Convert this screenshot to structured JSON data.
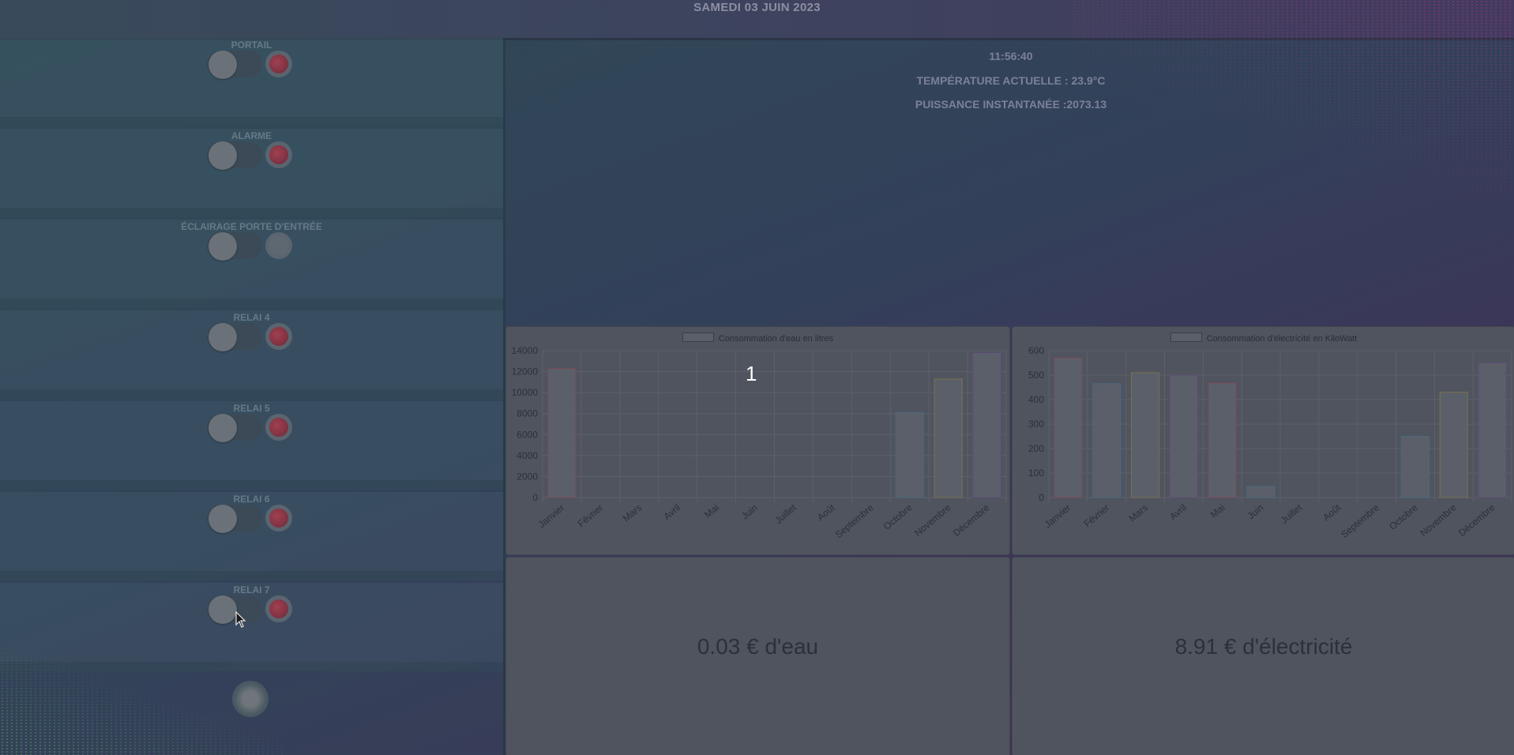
{
  "header": {
    "date": "SAMEDI 03 JUIN 2023"
  },
  "info": {
    "time": "11:56:40",
    "temperature": "TEMPÉRATURE ACTUELLE : 23.9°C",
    "power": "PUISSANCE INSTANTANÉE :2073.13"
  },
  "relays": [
    {
      "label": "PORTAIL",
      "led": "red"
    },
    {
      "label": "ALARME",
      "led": "red"
    },
    {
      "label": "ÉCLAIRAGE PORTE D'ENTRÉE",
      "led": "off"
    },
    {
      "label": "RELAI 4",
      "led": "red"
    },
    {
      "label": "RELAI 5",
      "led": "red"
    },
    {
      "label": "RELAI 6",
      "led": "red"
    },
    {
      "label": "RELAI 7",
      "led": "red"
    }
  ],
  "page_indicator": "1",
  "costs": {
    "water": "0.03 € d'eau",
    "electricity": "8.91 € d'électricité"
  },
  "colors": {
    "bar_fill": "#5b5f6a",
    "bar_stroke_red": "#7a4a55",
    "bar_stroke_blue": "#4a6a7e",
    "bar_stroke_yellow": "#7a7250",
    "bar_stroke_purple": "#5e4e78",
    "grid": "#5c616b",
    "tick_text": "#2c3039"
  },
  "chart_data": [
    {
      "type": "bar",
      "legend": "Consommation d'eau en litres",
      "categories": [
        "Janvier",
        "Février",
        "Mars",
        "Avril",
        "Mai",
        "Juin",
        "Juillet",
        "Août",
        "Septembre",
        "Octobre",
        "Novembre",
        "Décembre"
      ],
      "values": [
        12300,
        0,
        0,
        0,
        0,
        0,
        0,
        0,
        0,
        8100,
        11300,
        13800
      ],
      "yticks": [
        "0",
        "2000",
        "4000",
        "6000",
        "8000",
        "10000",
        "12000",
        "14000"
      ],
      "ylim": [
        0,
        14000
      ],
      "grid": true
    },
    {
      "type": "bar",
      "legend": "Consommation d'électricité en KiloWatt",
      "categories": [
        "Janvier",
        "Février",
        "Mars",
        "Avril",
        "Mai",
        "Juin",
        "Juillet",
        "Août",
        "Septembre",
        "Octobre",
        "Novembre",
        "Décembre"
      ],
      "values": [
        570,
        465,
        510,
        500,
        468,
        45,
        0,
        0,
        0,
        250,
        430,
        550
      ],
      "yticks": [
        "0",
        "100",
        "200",
        "300",
        "400",
        "500",
        "600"
      ],
      "ylim": [
        0,
        600
      ],
      "grid": true
    }
  ]
}
